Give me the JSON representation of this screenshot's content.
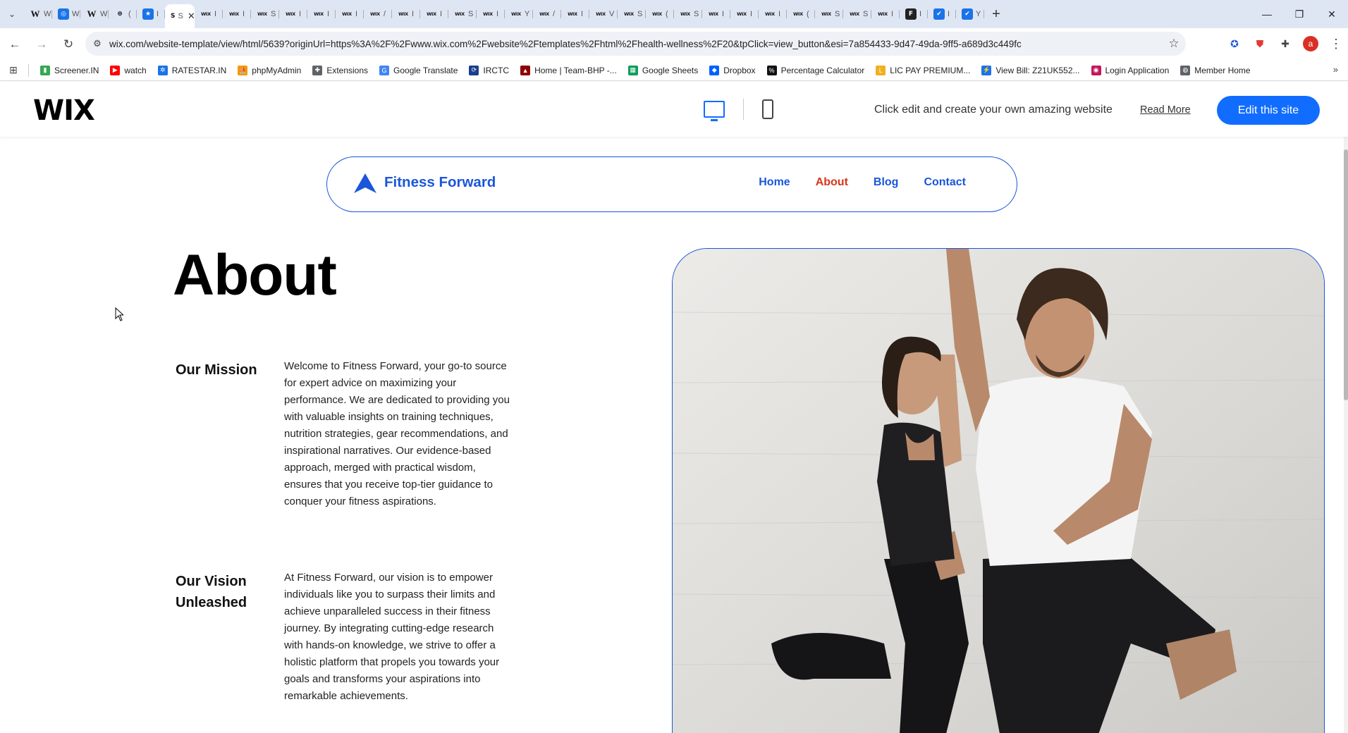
{
  "browser": {
    "tabs": [
      {
        "favicon": "W",
        "kind": "wiki",
        "text": "W"
      },
      {
        "favicon": "◎",
        "kind": "blue",
        "text": "W"
      },
      {
        "favicon": "W",
        "kind": "wiki",
        "text": "W"
      },
      {
        "favicon": "⊛",
        "kind": "plain",
        "text": "("
      },
      {
        "favicon": "★",
        "kind": "blue",
        "text": "I"
      },
      {
        "favicon": "S",
        "kind": "plain",
        "text": "S",
        "active": true
      },
      {
        "favicon": "WIX",
        "kind": "wix",
        "text": "I"
      },
      {
        "favicon": "WIX",
        "kind": "wix",
        "text": "I"
      },
      {
        "favicon": "WIX",
        "kind": "wix",
        "text": "S"
      },
      {
        "favicon": "WIX",
        "kind": "wix",
        "text": "I"
      },
      {
        "favicon": "WIX",
        "kind": "wix",
        "text": "I"
      },
      {
        "favicon": "WIX",
        "kind": "wix",
        "text": "I"
      },
      {
        "favicon": "WIX",
        "kind": "wix",
        "text": "/"
      },
      {
        "favicon": "WIX",
        "kind": "wix",
        "text": "I"
      },
      {
        "favicon": "WIX",
        "kind": "wix",
        "text": "I"
      },
      {
        "favicon": "WIX",
        "kind": "wix",
        "text": "S"
      },
      {
        "favicon": "WIX",
        "kind": "wix",
        "text": "I"
      },
      {
        "favicon": "WIX",
        "kind": "wix",
        "text": "Y"
      },
      {
        "favicon": "WIX",
        "kind": "wix",
        "text": "/"
      },
      {
        "favicon": "WIX",
        "kind": "wix",
        "text": "I"
      },
      {
        "favicon": "WIX",
        "kind": "wix",
        "text": "V"
      },
      {
        "favicon": "WIX",
        "kind": "wix",
        "text": "S"
      },
      {
        "favicon": "WIX",
        "kind": "wix",
        "text": "("
      },
      {
        "favicon": "WIX",
        "kind": "wix",
        "text": "S"
      },
      {
        "favicon": "WIX",
        "kind": "wix",
        "text": "I"
      },
      {
        "favicon": "WIX",
        "kind": "wix",
        "text": "I"
      },
      {
        "favicon": "WIX",
        "kind": "wix",
        "text": "I"
      },
      {
        "favicon": "WIX",
        "kind": "wix",
        "text": "("
      },
      {
        "favicon": "WIX",
        "kind": "wix",
        "text": "S"
      },
      {
        "favicon": "WIX",
        "kind": "wix",
        "text": "S"
      },
      {
        "favicon": "WIX",
        "kind": "wix",
        "text": "I"
      },
      {
        "favicon": "F",
        "kind": "dark",
        "text": "I"
      },
      {
        "favicon": "✔",
        "kind": "blue",
        "text": "I"
      },
      {
        "favicon": "✔",
        "kind": "blue",
        "text": "Y"
      }
    ],
    "new_tab": "+",
    "window_controls": {
      "minimize": "—",
      "restore": "❐",
      "close": "✕"
    },
    "back": "←",
    "forward": "→",
    "reload": "↻",
    "url": "wix.com/website-template/view/html/5639?originUrl=https%3A%2F%2Fwww.wix.com%2Fwebsite%2Ftemplates%2Fhtml%2Fhealth-wellness%2F20&tpClick=view_button&esi=7a854433-9d47-49da-9ff5-a689d3c449fc",
    "star": "☆",
    "avatar_letter": "a",
    "menu_dots": "⋮",
    "bookmarks": [
      {
        "label": "Screener.IN",
        "color": "#34a853",
        "glyph": "▮"
      },
      {
        "label": "watch",
        "color": "#ff0000",
        "glyph": "▶"
      },
      {
        "label": "RATESTAR.IN",
        "color": "#1a73e8",
        "glyph": "✲"
      },
      {
        "label": "phpMyAdmin",
        "color": "#f29b00",
        "glyph": "⛵"
      },
      {
        "label": "Extensions",
        "color": "#5f6368",
        "glyph": "✚"
      },
      {
        "label": "Google Translate",
        "color": "#4285f4",
        "glyph": "G"
      },
      {
        "label": "IRCTC",
        "color": "#1a3e8c",
        "glyph": "⟳"
      },
      {
        "label": "Home | Team-BHP -...",
        "color": "#8b0000",
        "glyph": "▲"
      },
      {
        "label": "Google Sheets",
        "color": "#0f9d58",
        "glyph": "▦"
      },
      {
        "label": "Dropbox",
        "color": "#0061ff",
        "glyph": "◆"
      },
      {
        "label": "Percentage Calculator",
        "color": "#111111",
        "glyph": "%"
      },
      {
        "label": "LIC PAY PREMIUM...",
        "color": "#f2b01e",
        "glyph": "L"
      },
      {
        "label": "View Bill: Z21UK552...",
        "color": "#1a73e8",
        "glyph": "⚡"
      },
      {
        "label": "Login Application",
        "color": "#c2185b",
        "glyph": "◉"
      },
      {
        "label": "Member Home",
        "color": "#5f6368",
        "glyph": "◍"
      }
    ],
    "bookmarks_more": "»"
  },
  "wix_banner": {
    "logo": "WIX",
    "promo_text": "Click edit and create your own amazing website",
    "read_more": "Read More",
    "edit_button": "Edit this site"
  },
  "site": {
    "brand": "Fitness Forward",
    "nav": [
      {
        "label": "Home",
        "active": false
      },
      {
        "label": "About",
        "active": true
      },
      {
        "label": "Blog",
        "active": false
      },
      {
        "label": "Contact",
        "active": false
      }
    ],
    "page_title": "About",
    "sections": [
      {
        "heading": "Our Mission",
        "body": "Welcome to Fitness Forward, your go-to source for expert advice on maximizing your performance. We are dedicated to providing you with valuable insights on training techniques, nutrition strategies, gear recommendations, and inspirational narratives. Our evidence-based approach, merged with practical wisdom, ensures that you receive top-tier guidance to conquer your fitness aspirations."
      },
      {
        "heading": "Our Vision Unleashed",
        "body": "At Fitness Forward, our vision is to empower individuals like you to surpass their limits and achieve unparalleled success in their fitness journey. By integrating cutting-edge research with hands-on knowledge, we strive to offer a holistic platform that propels you towards your goals and transforms your aspirations into remarkable achievements."
      }
    ]
  },
  "colors": {
    "wix_blue": "#116dff",
    "brand_blue": "#1a56db",
    "active_nav": "#d4361c"
  }
}
